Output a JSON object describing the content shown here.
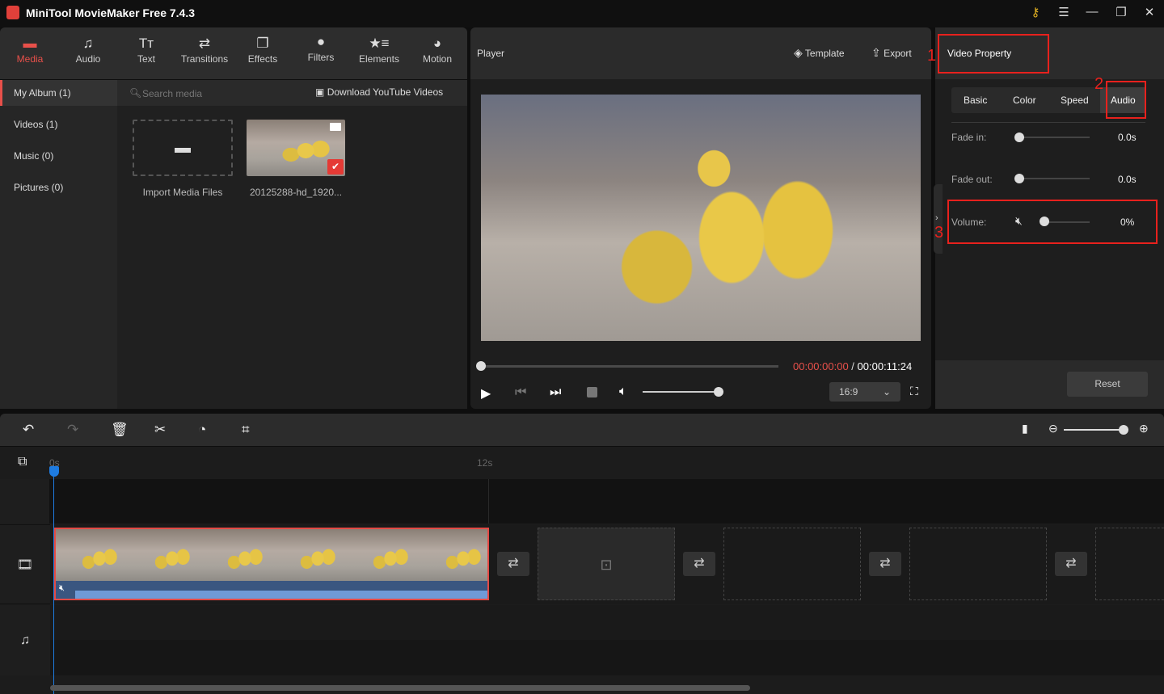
{
  "app": {
    "title": "MiniTool MovieMaker Free 7.4.3",
    "window_buttons": [
      "key-icon",
      "menu-icon",
      "minimize-icon",
      "maximize-icon",
      "close-icon"
    ]
  },
  "tabs": [
    {
      "label": "Media",
      "icon": "folder-icon",
      "active": true
    },
    {
      "label": "Audio",
      "icon": "music-icon"
    },
    {
      "label": "Text",
      "icon": "text-icon"
    },
    {
      "label": "Transitions",
      "icon": "transitions-icon"
    },
    {
      "label": "Effects",
      "icon": "effects-icon"
    },
    {
      "label": "Filters",
      "icon": "filters-icon"
    },
    {
      "label": "Elements",
      "icon": "elements-icon"
    },
    {
      "label": "Motion",
      "icon": "motion-icon"
    }
  ],
  "sidebar": {
    "items": [
      {
        "label": "My Album (1)",
        "active": true
      },
      {
        "label": "Videos (1)"
      },
      {
        "label": "Music (0)"
      },
      {
        "label": "Pictures (0)"
      }
    ]
  },
  "media": {
    "search_placeholder": "Search media",
    "download_label": "Download YouTube Videos",
    "import_label": "Import Media Files",
    "file_label": "20125288-hd_1920..."
  },
  "player": {
    "title": "Player",
    "template_label": "Template",
    "export_label": "Export",
    "current_time": "00:00:00:00",
    "separator": " / ",
    "total_time": "00:00:11:24",
    "aspect_ratio": "16:9",
    "progress": 0,
    "volume": 1.0
  },
  "property": {
    "title": "Video Property",
    "tabs": [
      "Basic",
      "Color",
      "Speed",
      "Audio"
    ],
    "active_tab": "Audio",
    "fade_in_label": "Fade in:",
    "fade_in_value": "0.0s",
    "fade_out_label": "Fade out:",
    "fade_out_value": "0.0s",
    "volume_label": "Volume:",
    "volume_value": "0%",
    "reset_label": "Reset"
  },
  "annotations": [
    "1",
    "2",
    "3"
  ],
  "timeline": {
    "ruler": [
      "0s",
      "12s"
    ]
  },
  "colors": {
    "accent": "#e8504a",
    "annotation": "#e8211d",
    "playhead": "#1e7be0",
    "waveform": "#6f9ad6"
  }
}
